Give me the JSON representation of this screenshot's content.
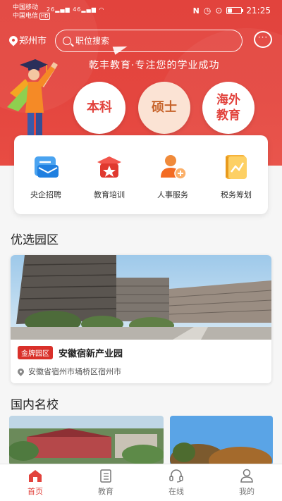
{
  "status_bar": {
    "carrier1": "中国移动",
    "carrier2": "中国电信",
    "hd": "HD",
    "net1": "26",
    "net2": "46",
    "time": "21:25"
  },
  "header": {
    "city": "郑州市",
    "search_placeholder": "职位搜索",
    "chat_icon": "chat-bubble-icon",
    "slogan": "乾丰教育·专注您的学业成功"
  },
  "degree_buttons": [
    {
      "label": "本科"
    },
    {
      "label": "硕士"
    },
    {
      "label": "海外\n教育"
    }
  ],
  "services": [
    {
      "label": "央企招聘",
      "icon": "envelope-icon"
    },
    {
      "label": "教育培训",
      "icon": "graduation-star-icon"
    },
    {
      "label": "人事服务",
      "icon": "person-add-icon"
    },
    {
      "label": "税务筹划",
      "icon": "chart-notebook-icon"
    }
  ],
  "sections": {
    "parks_title": "优选园区",
    "schools_title": "国内名校"
  },
  "park": {
    "badge": "金牌园区",
    "name": "安徽宿新产业园",
    "address": "安徽省宿州市埇桥区宿州市"
  },
  "nav": [
    {
      "label": "首页",
      "active": true
    },
    {
      "label": "教育",
      "active": false
    },
    {
      "label": "在线",
      "active": false
    },
    {
      "label": "我的",
      "active": false
    }
  ],
  "colors": {
    "accent": "#e2433d",
    "masters_bg": "#fbe3d4",
    "badge": "#d9302a"
  }
}
